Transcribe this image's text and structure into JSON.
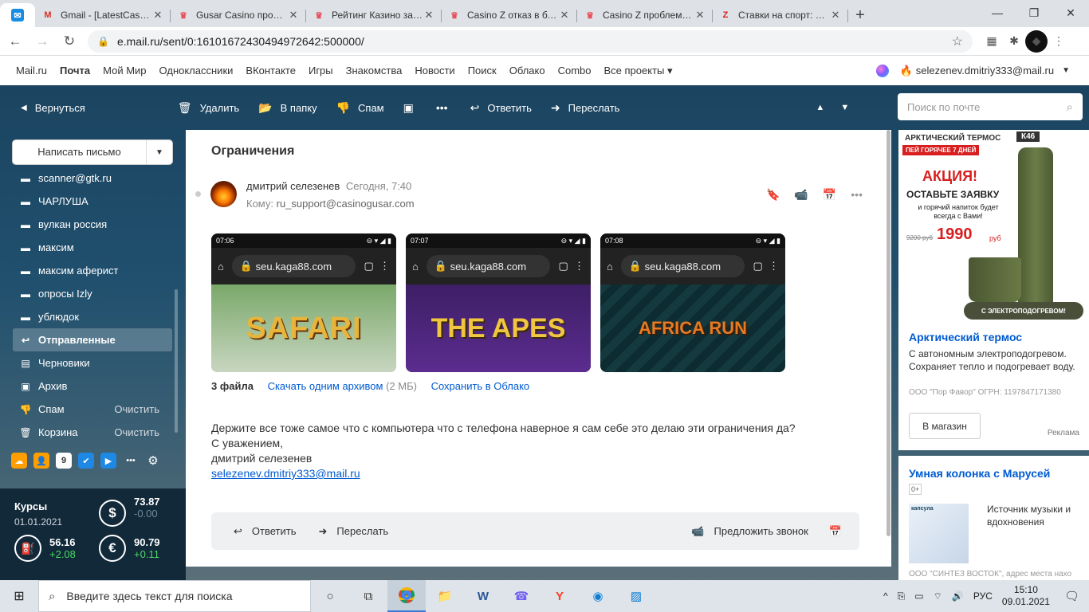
{
  "browser": {
    "tabs": [
      {
        "title": "Gmail - [LatestCasinoB",
        "icon": "gmail-icon",
        "color": "#d93025",
        "glyph": "M"
      },
      {
        "title": "Gusar Casino пробле",
        "icon": "casino-crown-icon",
        "color": "#e8505b",
        "glyph": "♛"
      },
      {
        "title": "Рейтинг Казино за Ян",
        "icon": "casino-crown-icon",
        "color": "#e8505b",
        "glyph": "♛"
      },
      {
        "title": "Casino Z отказ в блок",
        "icon": "casino-crown-icon",
        "color": "#e8505b",
        "glyph": "♛"
      },
      {
        "title": "Casino Z проблемы с",
        "icon": "casino-crown-icon",
        "color": "#e8505b",
        "glyph": "♛"
      },
      {
        "title": "Ставки на спорт: пра",
        "icon": "z-logo-icon",
        "color": "#d81e1e",
        "glyph": "Z"
      }
    ],
    "url": "e.mail.ru/sent/0:16101672430494972642:500000/"
  },
  "portal": {
    "links": [
      "Mail.ru",
      "Почта",
      "Мой Мир",
      "Одноклассники",
      "ВКонтакте",
      "Игры",
      "Знакомства",
      "Новости",
      "Поиск",
      "Облако",
      "Combo",
      "Все проекты ▾"
    ],
    "user_email": "selezenev.dmitriy333@mail.ru"
  },
  "toolbar": {
    "back": "Вернуться",
    "delete": "Удалить",
    "to_folder": "В папку",
    "spam": "Спам",
    "reply": "Ответить",
    "forward": "Переслать",
    "search_placeholder": "Поиск по почте"
  },
  "sidebar": {
    "compose": "Написать письмо",
    "folders": [
      {
        "name": "scanner@gtk.ru",
        "icon": "folder-icon",
        "selected": false,
        "action": ""
      },
      {
        "name": "ЧАРЛУША",
        "icon": "folder-icon",
        "selected": false,
        "action": ""
      },
      {
        "name": "вулкан россия",
        "icon": "folder-icon",
        "selected": false,
        "action": ""
      },
      {
        "name": "максим",
        "icon": "folder-icon",
        "selected": false,
        "action": ""
      },
      {
        "name": "максим аферист",
        "icon": "folder-icon",
        "selected": false,
        "action": ""
      },
      {
        "name": "опросы Izly",
        "icon": "folder-icon",
        "selected": false,
        "action": ""
      },
      {
        "name": "ублюдок",
        "icon": "folder-icon",
        "selected": false,
        "action": ""
      },
      {
        "name": "Отправленные",
        "icon": "sent-icon",
        "selected": true,
        "action": ""
      },
      {
        "name": "Черновики",
        "icon": "drafts-icon",
        "selected": false,
        "action": ""
      },
      {
        "name": "Архив",
        "icon": "archive-icon",
        "selected": false,
        "action": ""
      },
      {
        "name": "Спам",
        "icon": "spam-icon",
        "selected": false,
        "action": "Очистить"
      },
      {
        "name": "Корзина",
        "icon": "trash-icon",
        "selected": false,
        "action": "Очистить"
      }
    ]
  },
  "rates": {
    "title": "Курсы",
    "date": "01.01.2021",
    "usd": {
      "value": "73.87",
      "delta": "-0.00"
    },
    "oil": {
      "value": "56.16",
      "delta": "+2.08"
    },
    "eur": {
      "value": "90.79",
      "delta": "+0.11"
    }
  },
  "message": {
    "subject": "Ограничения",
    "sender": "дмитрий селезенев",
    "time": "Сегодня, 7:40",
    "to_label": "Кому:",
    "to": "ru_support@casinogusar.com",
    "attachments": [
      {
        "status_time": "07:06",
        "url": "seu.kaga88.com",
        "game": "SAFARI"
      },
      {
        "status_time": "07:07",
        "url": "seu.kaga88.com",
        "game": "THE APES"
      },
      {
        "status_time": "07:08",
        "url": "seu.kaga88.com",
        "game": "AFRICA RUN"
      }
    ],
    "files_count": "3 файла",
    "download_all": "Скачать одним архивом",
    "size": "(2 МБ)",
    "save_cloud": "Сохранить в Облако",
    "body_lines": [
      "Держите все тоже самое что с компьютера что с телефона наверное я сам себе это делаю эти ограничения да?",
      "С уважением,",
      "дмитрий селезенев"
    ],
    "signature_link": "selezenev.dmitriy333@mail.ru",
    "reply": "Ответить",
    "forward": "Переслать",
    "call": "Предложить звонок"
  },
  "ad1": {
    "header": "АРКТИЧЕСКИЙ ТЕРМОС",
    "badge": "К46",
    "promo": "ПЕЙ ГОРЯЧЕЕ 7 ДНЕЙ",
    "action": "АКЦИЯ!",
    "cta": "ОСТАВЬТЕ ЗАЯВКУ",
    "sub": "и горячий напиток будет всегда с Вами!",
    "old_price": "9200 руб",
    "new_price": "1990",
    "currency": "руб",
    "band": "С ЭЛЕКТРОПОДОГРЕВОМ!",
    "title": "Арктический термос",
    "desc": "С автономным электроподогревом. Сохраняет тепло и подогревает воду.",
    "legal": "ООО \"Пор Фавор\" ОГРН: 1197847171380",
    "button": "В магазин",
    "ad_label": "Реклама"
  },
  "ad2": {
    "title": "Умная колонка с Марусей",
    "age": "0+",
    "pic_text": "капсула",
    "text": "Источник музыки и вдохновения",
    "legal": "ООО \"СИНТЕЗ ВОСТОК\", адрес места нахо"
  },
  "taskbar": {
    "search_placeholder": "Введите здесь текст для поиска",
    "lang": "РУС",
    "time": "15:10",
    "date": "09.01.2021"
  }
}
